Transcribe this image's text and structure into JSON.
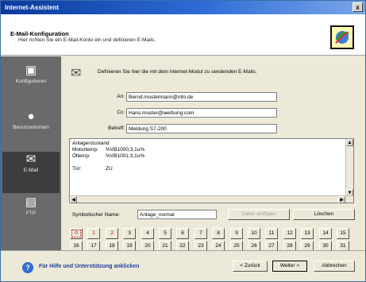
{
  "window": {
    "title": "Internet-Assistent",
    "close": "x"
  },
  "header": {
    "title": "E-Mail-Konfiguration",
    "subtitle": "Hier richten Sie ein E-Mail-Konto ein und definieren E-Mails."
  },
  "sidebar": {
    "items": [
      {
        "label": "Konfigurieren",
        "icon": "monitor-icon"
      },
      {
        "label": "Benutzerkonten",
        "icon": "users-icon"
      },
      {
        "label": "E-Mail",
        "icon": "mail-icon",
        "active": true
      },
      {
        "label": "FTP",
        "icon": "ftp-icon"
      }
    ]
  },
  "main": {
    "intro": "Definieren Sie hier die mit dem Internet-Modul zu sendenden E-Mails.",
    "fields": {
      "to": {
        "label": "An:",
        "value": "Bernd.mustermann@info.de"
      },
      "cc": {
        "label": "Cc:",
        "value": "Hans.muster@werbung.com"
      },
      "subject": {
        "label": "Betreff:",
        "value": "Meldung S7-200"
      }
    },
    "body": {
      "heading": "Anlagenzustand",
      "rows": [
        {
          "k": "Motortemp:",
          "v": "%VB1000;3,1u%"
        },
        {
          "k": "Öltemp:",
          "v": "%VB1001;3,1u%"
        },
        {
          "k": "Tür:",
          "v": "ZU"
        }
      ]
    },
    "symbol": {
      "label": "Symbolischer Name:",
      "value": "Anlage_normal"
    },
    "buttons": {
      "insert": "Daten einfügen",
      "delete": "Löschen"
    },
    "numbers": {
      "row1": [
        "0",
        "1",
        "2",
        "3",
        "4",
        "5",
        "6",
        "7",
        "8",
        "9",
        "10",
        "11",
        "12",
        "13",
        "14",
        "15"
      ],
      "row2": [
        "16",
        "17",
        "18",
        "19",
        "20",
        "21",
        "22",
        "23",
        "24",
        "25",
        "26",
        "27",
        "28",
        "29",
        "30",
        "31"
      ]
    }
  },
  "footer": {
    "help": "Für Hilfe und Unterstützung anklicken",
    "back": "< Zurück",
    "next": "Weiter >",
    "cancel": "Abbrechen"
  },
  "colors": {
    "titlebar": "#0a3a9c",
    "sidebar": "#6a6a6a",
    "accent_red": "#c00000",
    "help_text": "#1f3f9f"
  }
}
